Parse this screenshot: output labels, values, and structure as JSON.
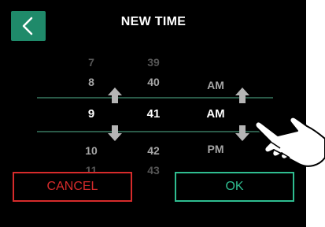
{
  "header": {
    "title": "NEW TIME",
    "back_icon": "chevron-left-icon"
  },
  "picker": {
    "hours": [
      "7",
      "8",
      "9",
      "10",
      "11"
    ],
    "minutes": [
      "39",
      "40",
      "41",
      "42",
      "43"
    ],
    "period": [
      "AM",
      "AM",
      "PM"
    ],
    "selected": {
      "hour": "9",
      "minute": "41",
      "period": "AM"
    }
  },
  "icons": {
    "up": "arrow-up-icon",
    "down": "arrow-down-icon",
    "hand": "pointing-hand-icon"
  },
  "footer": {
    "cancel_label": "CANCEL",
    "ok_label": "OK"
  },
  "colors": {
    "background": "#000000",
    "accent": "#1f8a6a",
    "cancel": "#d62b2b",
    "ok": "#2fbd90",
    "divider": "#2a5a48",
    "arrow": "#b5b5b5"
  }
}
